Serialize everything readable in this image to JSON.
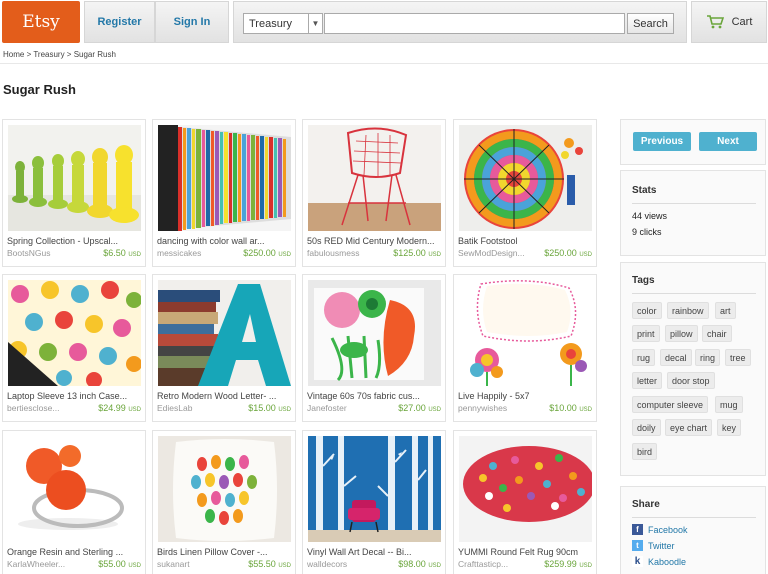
{
  "header": {
    "logo": "Etsy",
    "register": "Register",
    "signin": "Sign In",
    "search_scope": "Treasury",
    "search_value": "",
    "search_button": "Search",
    "cart": "Cart"
  },
  "breadcrumb": "Home > Treasury > Sugar Rush",
  "title": "Sugar Rush",
  "items": [
    {
      "title": "Spring Collection - Upscal...",
      "shop": "BootsNGus",
      "price": "$6.50",
      "cur": "USD"
    },
    {
      "title": "dancing with color wall ar...",
      "shop": "messicakes",
      "price": "$250.00",
      "cur": "USD"
    },
    {
      "title": "50s RED Mid Century Modern...",
      "shop": "fabulousmess",
      "price": "$125.00",
      "cur": "USD"
    },
    {
      "title": "Batik Footstool",
      "shop": "SewModDesign...",
      "price": "$250.00",
      "cur": "USD"
    },
    {
      "title": "Laptop Sleeve 13 inch Case...",
      "shop": "bertiesclose...",
      "price": "$24.99",
      "cur": "USD"
    },
    {
      "title": "Retro Modern Wood Letter- ...",
      "shop": "EdiesLab",
      "price": "$15.00",
      "cur": "USD"
    },
    {
      "title": "Vintage 60s 70s fabric cus...",
      "shop": "Janefoster",
      "price": "$27.00",
      "cur": "USD"
    },
    {
      "title": "Live Happily - 5x7",
      "shop": "pennywishes",
      "price": "$10.00",
      "cur": "USD"
    },
    {
      "title": "Orange Resin and Sterling ...",
      "shop": "KarlaWheeler...",
      "price": "$55.00",
      "cur": "USD"
    },
    {
      "title": "Birds Linen Pillow Cover -...",
      "shop": "sukanart",
      "price": "$55.50",
      "cur": "USD"
    },
    {
      "title": "Vinyl Wall Art Decal -- Bi...",
      "shop": "walldecors",
      "price": "$98.00",
      "cur": "USD"
    },
    {
      "title": "YUMMI Round Felt Rug 90cm",
      "shop": "Crafttasticp...",
      "price": "$259.99",
      "cur": "USD"
    }
  ],
  "sidebar": {
    "previous": "Previous",
    "next": "Next",
    "stats_heading": "Stats",
    "views": "44 views",
    "clicks": "9 clicks",
    "tags_heading": "Tags",
    "tags": [
      "color",
      "rainbow",
      "art",
      "print",
      "pillow",
      "chair",
      "rug",
      "decal",
      "ring",
      "tree",
      "letter",
      "door stop",
      "computer sleeve",
      "mug",
      "doily",
      "eye chart",
      "key",
      "bird"
    ],
    "share_heading": "Share",
    "share": [
      "Facebook",
      "Twitter",
      "Kaboodle"
    ]
  },
  "colors": {
    "etsy_orange": "#e35d1b",
    "link_blue": "#2378a8",
    "button_blue": "#4fb1cf",
    "price_green": "#6aa53b"
  }
}
